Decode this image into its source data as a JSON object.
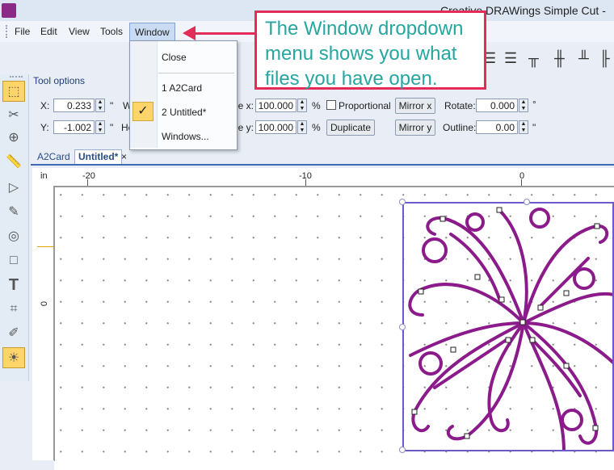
{
  "app": {
    "title": "Creative DRAWings Simple Cut -"
  },
  "menubar": {
    "items": [
      "File",
      "Edit",
      "View",
      "Tools",
      "Window"
    ]
  },
  "callout": {
    "lines": [
      "The Window dropdown",
      "menu shows you what",
      "files you have open."
    ]
  },
  "window_menu": {
    "items": [
      {
        "label": "Close"
      },
      {
        "label": "1 A2Card"
      },
      {
        "label": "2 Untitled*",
        "checked": true
      },
      {
        "label": "Windows..."
      }
    ],
    "check_glyph": "✓"
  },
  "tool_options": {
    "title": "Tool options",
    "x_label": "X:",
    "x_value": "0.233",
    "x_unit": "\"",
    "y_label": "Y:",
    "y_value": "-1.002",
    "y_unit": "\"",
    "w_label": "W",
    "h_label": "He",
    "scalex_label": "le x:",
    "scalex_value": "100.000",
    "scalex_unit": "%",
    "scaley_label": "le y:",
    "scaley_value": "100.000",
    "scaley_unit": "%",
    "proportional_label": "Proportional",
    "duplicate_label": "Duplicate",
    "mirrorx_label": "Mirror x",
    "mirrory_label": "Mirror y",
    "rotate_label": "Rotate:",
    "rotate_value": "0.000",
    "rotate_unit": "°",
    "outline_label": "Outline:",
    "outline_value": "0.00",
    "outline_unit": "\""
  },
  "tabs": [
    {
      "label": "A2Card"
    },
    {
      "label": "Untitled*",
      "active": true
    }
  ],
  "tab_close": "×",
  "ruler": {
    "unit": "in",
    "top_labels": [
      "-20",
      "-10",
      "0"
    ],
    "left_label": "0"
  },
  "toolbox_icons": [
    "select-tool-icon",
    "shape-edit-icon",
    "zoom-icon",
    "ruler-icon",
    "node-edit-icon",
    "brush-icon",
    "spiral-icon",
    "rectangle-icon",
    "text-icon",
    "grid-icon",
    "eyedropper-icon",
    "lightbulb-icon"
  ],
  "colors": {
    "accent": "#e32c57",
    "callout_text": "#27a6a0",
    "design": "#8b1a8a",
    "selection": "#6a5acd"
  }
}
